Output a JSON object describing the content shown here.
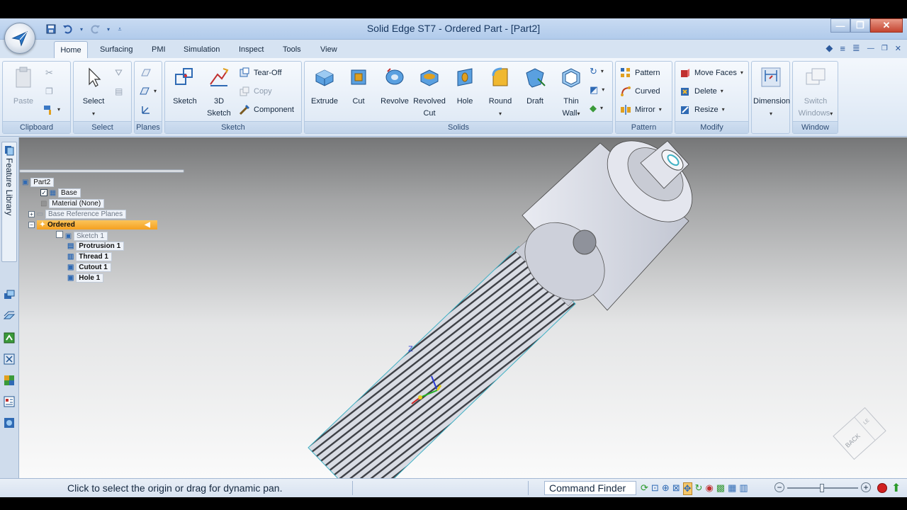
{
  "window": {
    "title": "Solid Edge ST7 - Ordered Part - [Part2]"
  },
  "tabs": [
    "Home",
    "Surfacing",
    "PMI",
    "Simulation",
    "Inspect",
    "Tools",
    "View"
  ],
  "ribbon": {
    "clipboard": {
      "label": "Clipboard",
      "paste": "Paste"
    },
    "select": {
      "label": "Select",
      "select": "Select"
    },
    "planes": {
      "label": "Planes"
    },
    "sketch": {
      "label": "Sketch",
      "sketch": "Sketch",
      "sketch3d_1": "3D",
      "sketch3d_2": "Sketch",
      "tearoff": "Tear-Off",
      "copy": "Copy",
      "component": "Component"
    },
    "solids": {
      "label": "Solids",
      "extrude": "Extrude",
      "cut": "Cut",
      "revolve": "Revolve",
      "revolved_cut_1": "Revolved",
      "revolved_cut_2": "Cut",
      "hole": "Hole",
      "round": "Round",
      "draft": "Draft",
      "thin_wall_1": "Thin",
      "thin_wall_2": "Wall"
    },
    "pattern": {
      "label": "Pattern",
      "pattern": "Pattern",
      "curved": "Curved",
      "mirror": "Mirror"
    },
    "modify": {
      "label": "Modify",
      "move_faces": "Move Faces",
      "delete": "Delete",
      "resize": "Resize"
    },
    "dimension": {
      "dimension": "Dimension"
    },
    "window_group": {
      "label": "Window",
      "switch_1": "Switch",
      "switch_2": "Windows"
    }
  },
  "sidebar": {
    "feature_library": "Feature Library"
  },
  "tree": {
    "root": "Part2",
    "base": "Base",
    "material": "Material (None)",
    "base_ref": "Base Reference Planes",
    "ordered": "Ordered",
    "sketch1": "Sketch 1",
    "protrusion1": "Protrusion 1",
    "thread1": "Thread 1",
    "cutout1": "Cutout 1",
    "hole1": "Hole 1"
  },
  "viewcube": {
    "face": "BACK",
    "side": "LE"
  },
  "triad": {
    "z": "Z"
  },
  "status": {
    "message": "Click to select the origin or drag for dynamic pan.",
    "command_finder": "Command Finder"
  }
}
